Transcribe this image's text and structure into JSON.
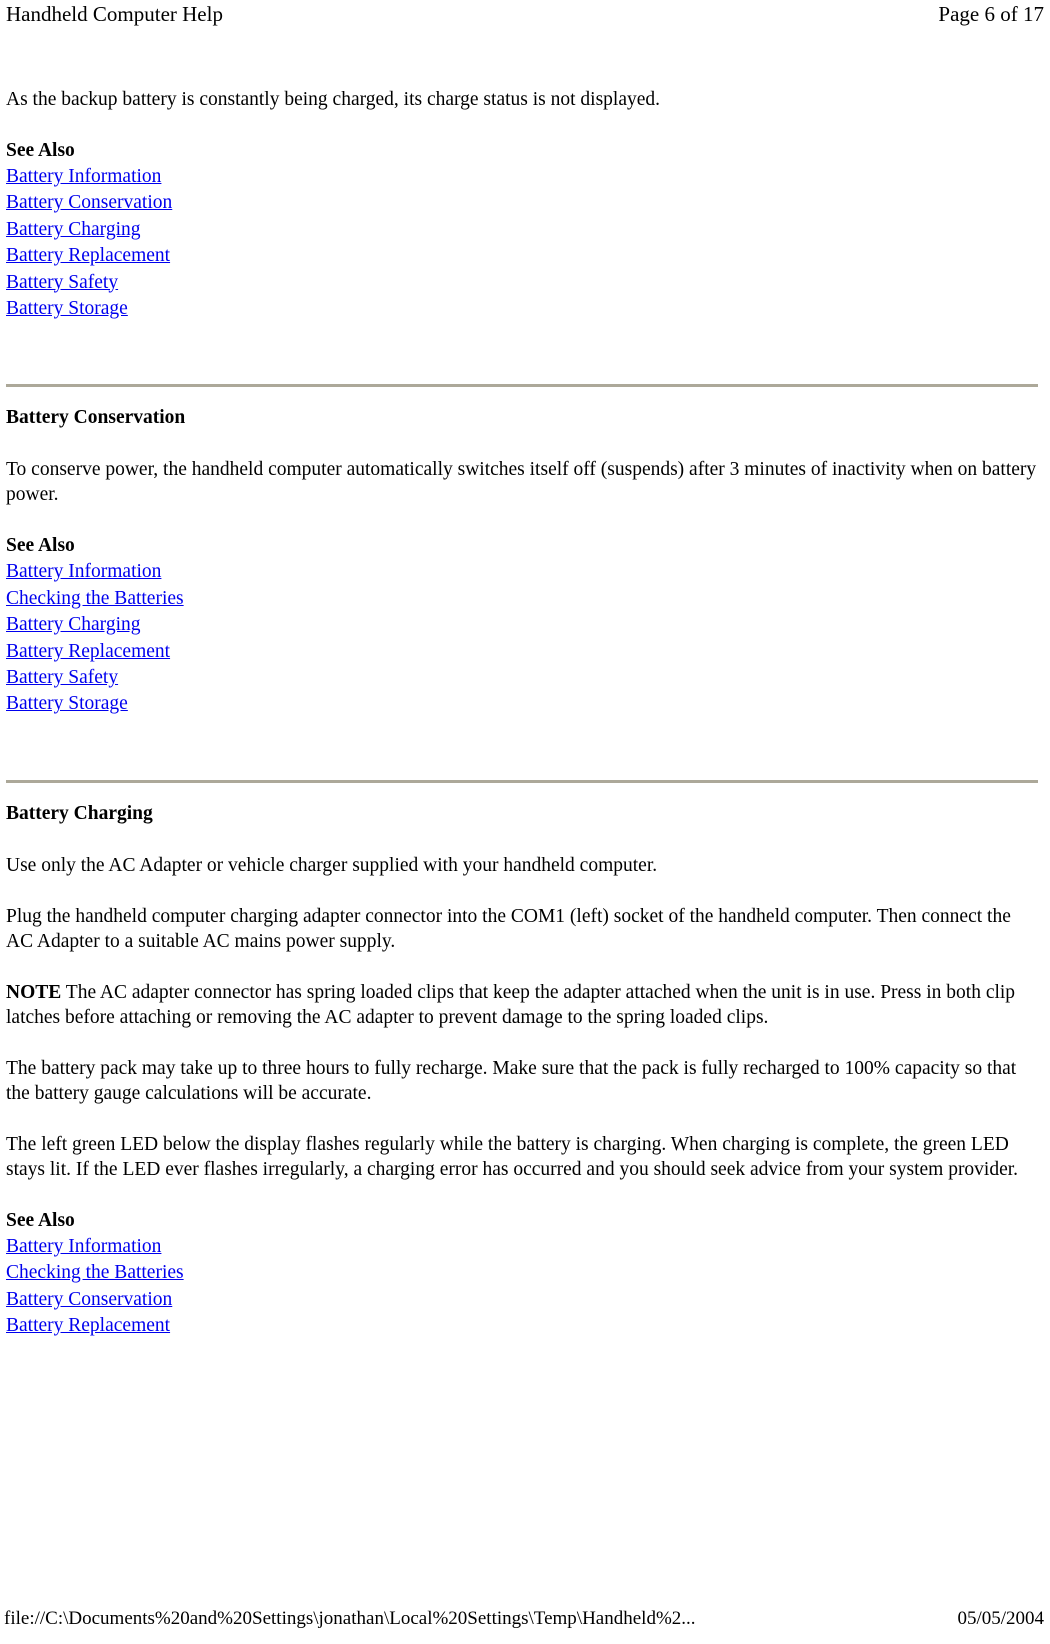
{
  "header": {
    "title": "Handheld Computer Help",
    "page_indicator": "Page 6 of 17"
  },
  "sections": {
    "checking_batteries_tail": {
      "paragraph": "As the backup battery is constantly being charged, its charge status is not displayed.",
      "see_also_label": "See Also",
      "links": [
        "Battery Information",
        "Battery Conservation",
        "Battery Charging",
        "Battery Replacement",
        "Battery Safety",
        "Battery Storage"
      ]
    },
    "battery_conservation": {
      "title": "Battery Conservation",
      "paragraph": "To conserve power, the handheld computer automatically switches itself off (suspends) after 3 minutes of inactivity when on battery power.",
      "see_also_label": "See Also",
      "links": [
        "Battery Information",
        "Checking the Batteries",
        "Battery Charging",
        "Battery Replacement",
        "Battery Safety",
        "Battery Storage"
      ]
    },
    "battery_charging": {
      "title": "Battery Charging",
      "paragraph_1": "Use only the AC Adapter or vehicle charger supplied with your handheld computer.",
      "paragraph_2": "Plug the handheld computer charging adapter connector into the COM1 (left) socket of the handheld computer. Then connect the AC Adapter to a suitable AC mains power supply.",
      "note_label": "NOTE",
      "note_text": "  The AC adapter connector has spring loaded clips that keep the adapter attached when the unit is in use. Press in both clip latches before attaching or removing the AC adapter to prevent damage to the spring loaded clips.",
      "paragraph_3": "The battery pack may take up to three hours to fully recharge. Make sure that the pack is fully recharged to 100% capacity so that the battery gauge calculations will be accurate.",
      "paragraph_4": "The left green LED below the display flashes regularly while the battery is charging. When charging is complete, the green LED stays lit. If the LED ever flashes irregularly, a charging error has occurred and you should seek advice from your system provider.",
      "see_also_label": "See Also",
      "links": [
        "Battery Information",
        "Checking the Batteries",
        "Battery Conservation",
        "Battery Replacement"
      ]
    }
  },
  "footer": {
    "path": "file://C:\\Documents%20and%20Settings\\jonathan\\Local%20Settings\\Temp\\Handheld%2...",
    "date": "05/05/2004"
  },
  "colors": {
    "link": "#0000ee",
    "rule": "#aca899",
    "text": "#000000",
    "background": "#ffffff"
  }
}
